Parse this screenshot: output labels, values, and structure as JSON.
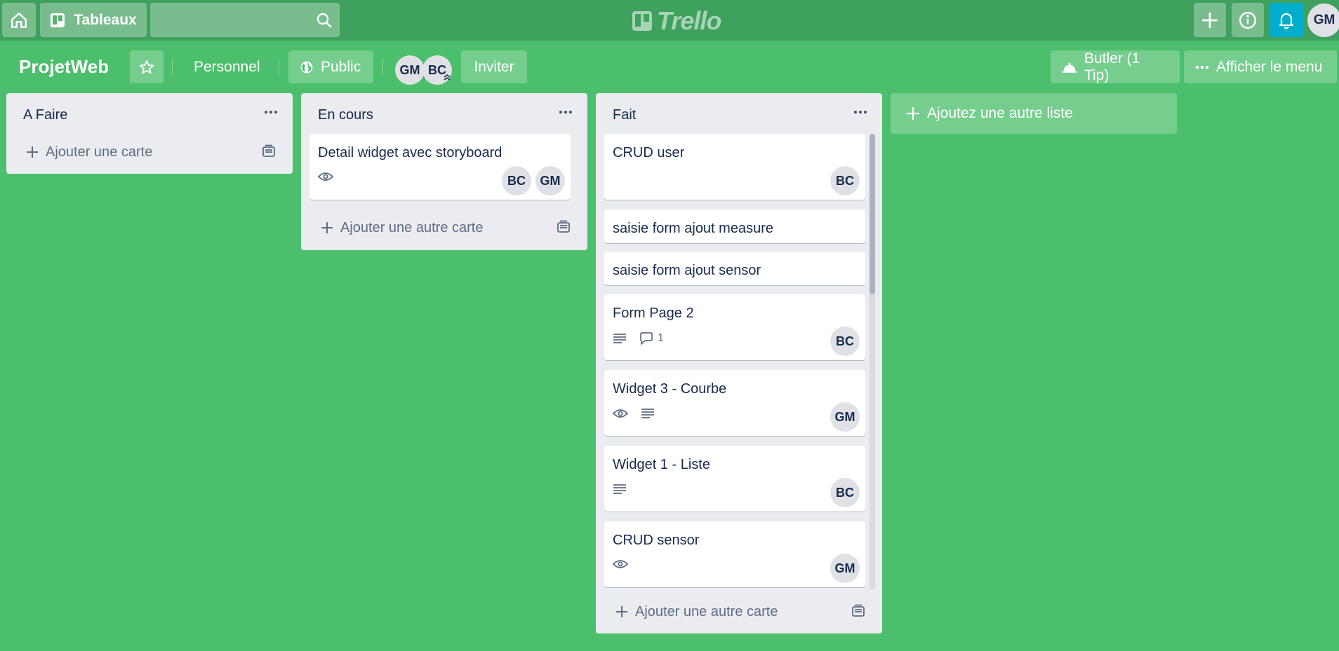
{
  "header": {
    "boards_label": "Tableaux",
    "search_placeholder": "",
    "logo_text": "Trello",
    "user_initials": "GM",
    "bell_color": "#00aecc"
  },
  "board": {
    "title": "ProjetWeb",
    "team_label": "Personnel",
    "visibility_label": "Public",
    "members": [
      "GM",
      "BC"
    ],
    "invite_label": "Inviter",
    "butler_label": "Butler (1 Tip)",
    "menu_label": "Afficher le menu",
    "background_color": "#4bbf6b"
  },
  "lists": [
    {
      "title": "A Faire",
      "add_card_label": "Ajouter une carte",
      "cards": []
    },
    {
      "title": "En cours",
      "add_card_label": "Ajouter une autre carte",
      "cards": [
        {
          "title": "Detail widget avec storyboard",
          "watch": true,
          "description": false,
          "comments": null,
          "members": [
            "BC",
            "GM"
          ]
        }
      ]
    },
    {
      "title": "Fait",
      "add_card_label": "Ajouter une autre carte",
      "cards": [
        {
          "title": "CRUD user",
          "watch": false,
          "description": false,
          "comments": null,
          "members": [
            "BC"
          ]
        },
        {
          "title": "saisie form ajout measure",
          "watch": false,
          "description": false,
          "comments": null,
          "members": []
        },
        {
          "title": "saisie form ajout sensor",
          "watch": false,
          "description": false,
          "comments": null,
          "members": []
        },
        {
          "title": "Form Page 2",
          "watch": false,
          "description": true,
          "comments": "1",
          "members": [
            "BC"
          ]
        },
        {
          "title": "Widget 3 - Courbe",
          "watch": true,
          "description": true,
          "comments": null,
          "members": [
            "GM"
          ]
        },
        {
          "title": "Widget 1 - Liste",
          "watch": false,
          "description": true,
          "comments": null,
          "members": [
            "BC"
          ]
        },
        {
          "title": "CRUD sensor",
          "watch": true,
          "description": false,
          "comments": null,
          "members": [
            "GM"
          ]
        }
      ]
    }
  ],
  "add_list_label": "Ajoutez une autre liste"
}
